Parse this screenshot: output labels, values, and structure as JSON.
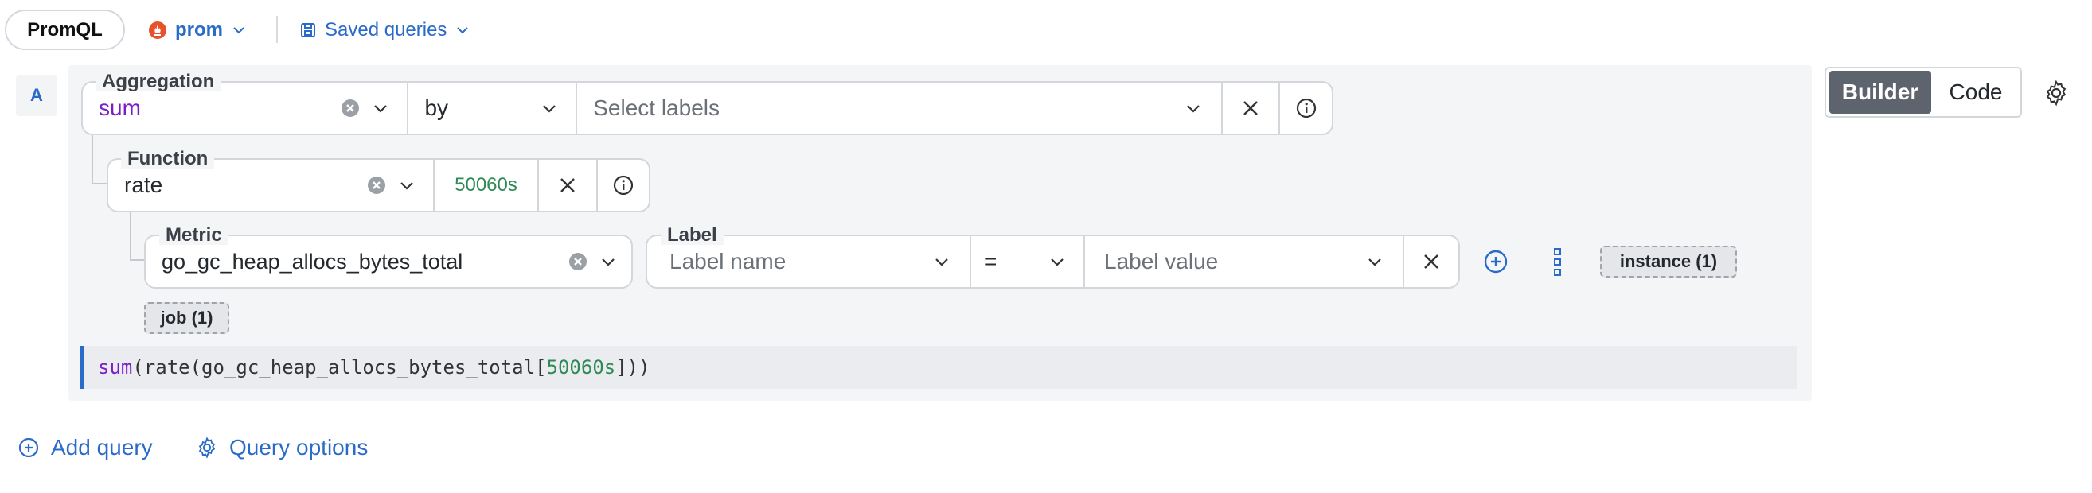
{
  "toolbar": {
    "query_language": "PromQL",
    "datasource": "prom",
    "saved_queries": "Saved queries"
  },
  "query": {
    "letter": "A",
    "aggregation": {
      "legend": "Aggregation",
      "value": "sum",
      "by_value": "by",
      "labels_placeholder": "Select labels"
    },
    "function": {
      "legend": "Function",
      "value": "rate",
      "range": "50060s"
    },
    "metric": {
      "legend": "Metric",
      "value": "go_gc_heap_allocs_bytes_total"
    },
    "label": {
      "legend": "Label",
      "name_placeholder": "Label name",
      "operator": "=",
      "value_placeholder": "Label value"
    },
    "hints": {
      "instance": "instance (1)",
      "job": "job (1)"
    },
    "raw": {
      "agg": "sum",
      "open_rate": "(rate(go_gc_heap_allocs_bytes_total[",
      "range": "50060s",
      "close": "]))"
    }
  },
  "mode": {
    "builder": "Builder",
    "code": "Code"
  },
  "footer": {
    "add_query": "Add query",
    "query_options": "Query options"
  },
  "colors": {
    "link": "#2a6ac8",
    "keyword": "#7a1ec8",
    "duration": "#2f8a55",
    "active_mode": "#5d646d"
  }
}
